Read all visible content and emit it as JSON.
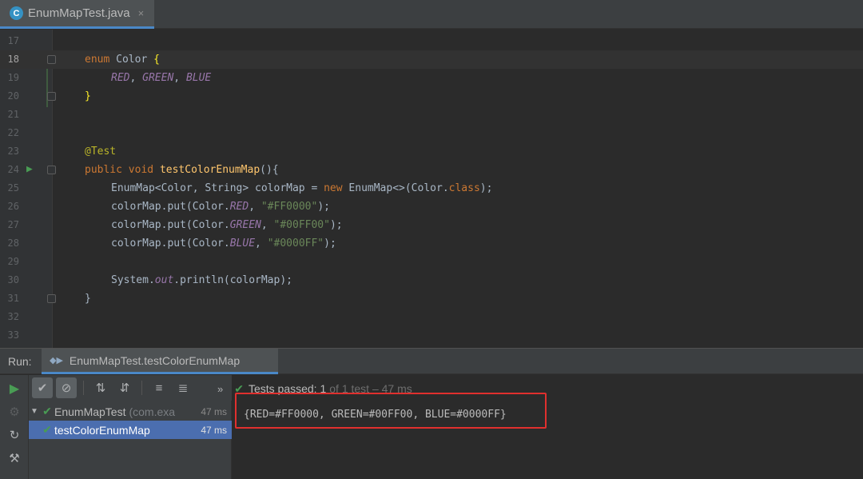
{
  "tab": {
    "title": "EnumMapTest.java",
    "icon": "java-class-icon",
    "close": "×"
  },
  "editor": {
    "lines": [
      {
        "num": "17"
      },
      {
        "num": "18"
      },
      {
        "num": "19"
      },
      {
        "num": "20"
      },
      {
        "num": "21"
      },
      {
        "num": "22"
      },
      {
        "num": "23"
      },
      {
        "num": "24"
      },
      {
        "num": "25"
      },
      {
        "num": "26"
      },
      {
        "num": "27"
      },
      {
        "num": "28"
      },
      {
        "num": "29"
      },
      {
        "num": "30"
      },
      {
        "num": "31"
      },
      {
        "num": "32"
      },
      {
        "num": "33"
      }
    ],
    "code": {
      "l18_kw": "enum",
      "l18_name": " Color ",
      "l18_brace": "{",
      "l19_red": "RED",
      "l19_sep1": ", ",
      "l19_green": "GREEN",
      "l19_sep2": ", ",
      "l19_blue": "BLUE",
      "l20_brace": "}",
      "l23_ann": "@Test",
      "l24_public": "public",
      "l24_void": "void",
      "l24_fn": "testColorEnumMap",
      "l24_rest": "(){",
      "l25_a": "EnumMap<Color, String> colorMap = ",
      "l25_new": "new",
      "l25_b": " EnumMap<>(Color.",
      "l25_class": "class",
      "l25_c": ");",
      "l26_a": "colorMap.put(Color.",
      "l26_enum": "RED",
      "l26_b": ", ",
      "l26_str": "\"#FF0000\"",
      "l26_c": ");",
      "l27_a": "colorMap.put(Color.",
      "l27_enum": "GREEN",
      "l27_b": ", ",
      "l27_str": "\"#00FF00\"",
      "l27_c": ");",
      "l28_a": "colorMap.put(Color.",
      "l28_enum": "BLUE",
      "l28_b": ", ",
      "l28_str": "\"#0000FF\"",
      "l28_c": ");",
      "l30_a": "System.",
      "l30_out": "out",
      "l30_b": ".println(colorMap);",
      "l31_brace": "}"
    }
  },
  "run": {
    "label": "Run:",
    "tab_title": "EnumMapTest.testColorEnumMap",
    "status": {
      "more": "»",
      "passed": "Tests passed: 1",
      "detail": "of 1 test – 47 ms"
    },
    "tree": [
      {
        "name": "EnumMapTest",
        "pkg": "(com.exa",
        "time": "47 ms"
      },
      {
        "name": "testColorEnumMap",
        "time": "47 ms"
      }
    ],
    "output": "{RED=#FF0000, GREEN=#00FF00, BLUE=#0000FF}"
  },
  "colors": {
    "background": "#2b2b2b",
    "keyword": "#cc7832",
    "string": "#6a8759",
    "function": "#ffc66d",
    "enum_const": "#9876aa",
    "annotation": "#bbb529",
    "pass": "#499c54",
    "selection": "#4b6eaf",
    "highlight_box": "#e0302e"
  }
}
